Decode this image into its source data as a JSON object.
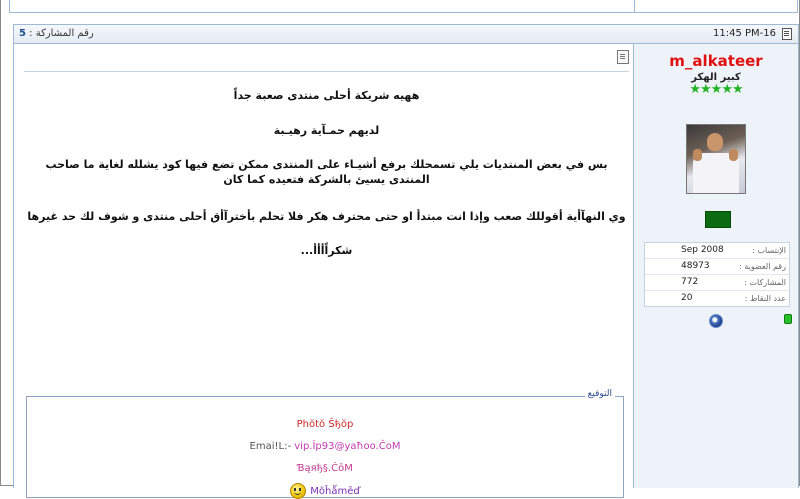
{
  "post": {
    "time": "11:45 PM-16",
    "number_label": "رقم المشاركة :",
    "number": "5"
  },
  "user": {
    "name": "m_alkateer",
    "title": "كبير الهكر",
    "stars": "★★★★★",
    "info": [
      {
        "label": "الإنتساب :",
        "value": "Sep 2008"
      },
      {
        "label": "رقم العضوية :",
        "value": "48973"
      },
      {
        "label": "المشاركات :",
        "value": "772"
      },
      {
        "label": "عدد النقاط :",
        "value": "20"
      }
    ]
  },
  "message": {
    "line1": "ههيه شريكة أحلى منتدى صعبة جداً",
    "line2": "لديهم حمـآية رهيـبة",
    "line3": "بس في بعض المنتديات يلي تسمحلك برفع أشيـاء على المنتدى ممكن تضع فيها كود يشلله لغاية ما صاحب المنتدى يسيئ بالشركة فتعيده كما كان",
    "line4": "وي النهآأية أقوللك صعب وإذا انت مبتدأ او حتى محترف هكر فلا تحلم بأخترآأق أحلى منتدى و شوف لك حد غيرها",
    "line5": "شكراًأأأ..."
  },
  "signature": {
    "legend": "التوقيع",
    "line1": "Phŏtŏ Ŝђŏp",
    "line2_prefix": "Emai!L:-",
    "line2_value": "vip.İp93@yaħoo.ČoM",
    "line3": "Ɓąяђ§.ĊōM",
    "line4": "Mŏĥǻmēď"
  },
  "colors": {
    "accent": "#1f4f8f",
    "username": "#e01010",
    "stars": "#25b225"
  }
}
